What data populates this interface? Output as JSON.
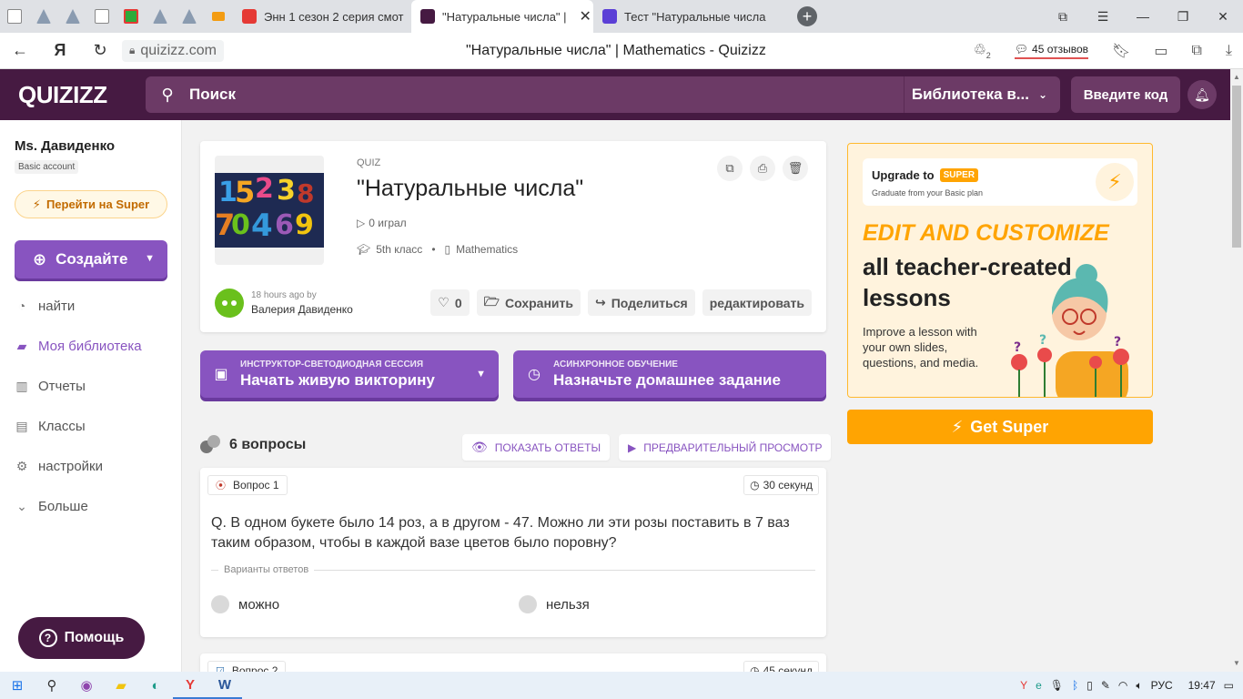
{
  "browser": {
    "tabs": [
      {
        "label": "Энн 1 сезон 2 серия смот",
        "color": "#e53935"
      },
      {
        "label": "\"Натуральные числа\" |",
        "color": "#461a42"
      },
      {
        "label": "Тест \"Натуральные числа",
        "color": "#5b3fd6"
      }
    ],
    "url": "quizizz.com",
    "page_title": "\"Натуральные числа\" | Mathematics - Quizizz",
    "reviews": "45 отзывов",
    "badge_count": "2"
  },
  "header": {
    "logo": "QUIZIZZ",
    "search_placeholder": "Поиск",
    "library": "Библиотека в...",
    "join_code": "Введите код"
  },
  "sidebar": {
    "user_name": "Ms. Давиденко",
    "account": "Basic account",
    "go_super": "Перейти на Super",
    "create": "Создайте",
    "nav": [
      {
        "label": "найти",
        "icon": "compass-icon"
      },
      {
        "label": "Моя библиотека",
        "icon": "folder-icon"
      },
      {
        "label": "Отчеты",
        "icon": "chart-icon"
      },
      {
        "label": "Классы",
        "icon": "classes-icon"
      },
      {
        "label": "настройки",
        "icon": "gear-icon"
      },
      {
        "label": "Больше",
        "icon": "chevron-down-icon"
      }
    ],
    "help": "Помощь"
  },
  "quiz": {
    "type": "QUIZ",
    "title": "\"Натуральные числа\"",
    "played": "0 играл",
    "grade": "5th класс",
    "subject": "Mathematics",
    "when": "18 hours ago by",
    "author": "Валерия Давиденко",
    "likes": "0",
    "save": "Сохранить",
    "share": "Поделиться",
    "edit": "редактировать"
  },
  "actions": {
    "live_small": "ИНСТРУКТОР-СВЕТОДИОДНАЯ СЕССИЯ",
    "live_big": "Начать живую викторину",
    "hw_small": "АСИНХРОННОЕ ОБУЧЕНИЕ",
    "hw_big": "Назначьте домашнее задание"
  },
  "questions": {
    "count_label": "6 вопросы",
    "show_answers": "ПОКАЗАТЬ ОТВЕТЫ",
    "preview": "ПРЕДВАРИТЕЛЬНЫЙ ПРОСМОТР",
    "items": [
      {
        "number": "Вопрос 1",
        "time": "30 секунд",
        "text": "Q. В одном букете было 14 роз, а в другом - 47. Можно ли эти розы поставить в 7 ваз таким образом, чтобы в каждой вазе цветов было поровну?",
        "options_label": "Варианты ответов",
        "options": [
          "можно",
          "нельзя"
        ]
      },
      {
        "number": "Вопрос 2",
        "time": "45 секунд"
      }
    ]
  },
  "upgrade": {
    "title": "Upgrade to",
    "super_badge": "SUPER",
    "subtitle": "Graduate from your Basic plan",
    "headline_accent": "EDIT AND CUSTOMIZE",
    "headline": "all teacher-created lessons",
    "body": "Improve a lesson with your own slides, questions, and media.",
    "cta": "Get Super"
  },
  "taskbar": {
    "lang": "РУС",
    "time": "19:47"
  },
  "colors": {
    "brand_dark": "#461a42",
    "primary": "#8854c0",
    "super": "#ffa402"
  }
}
